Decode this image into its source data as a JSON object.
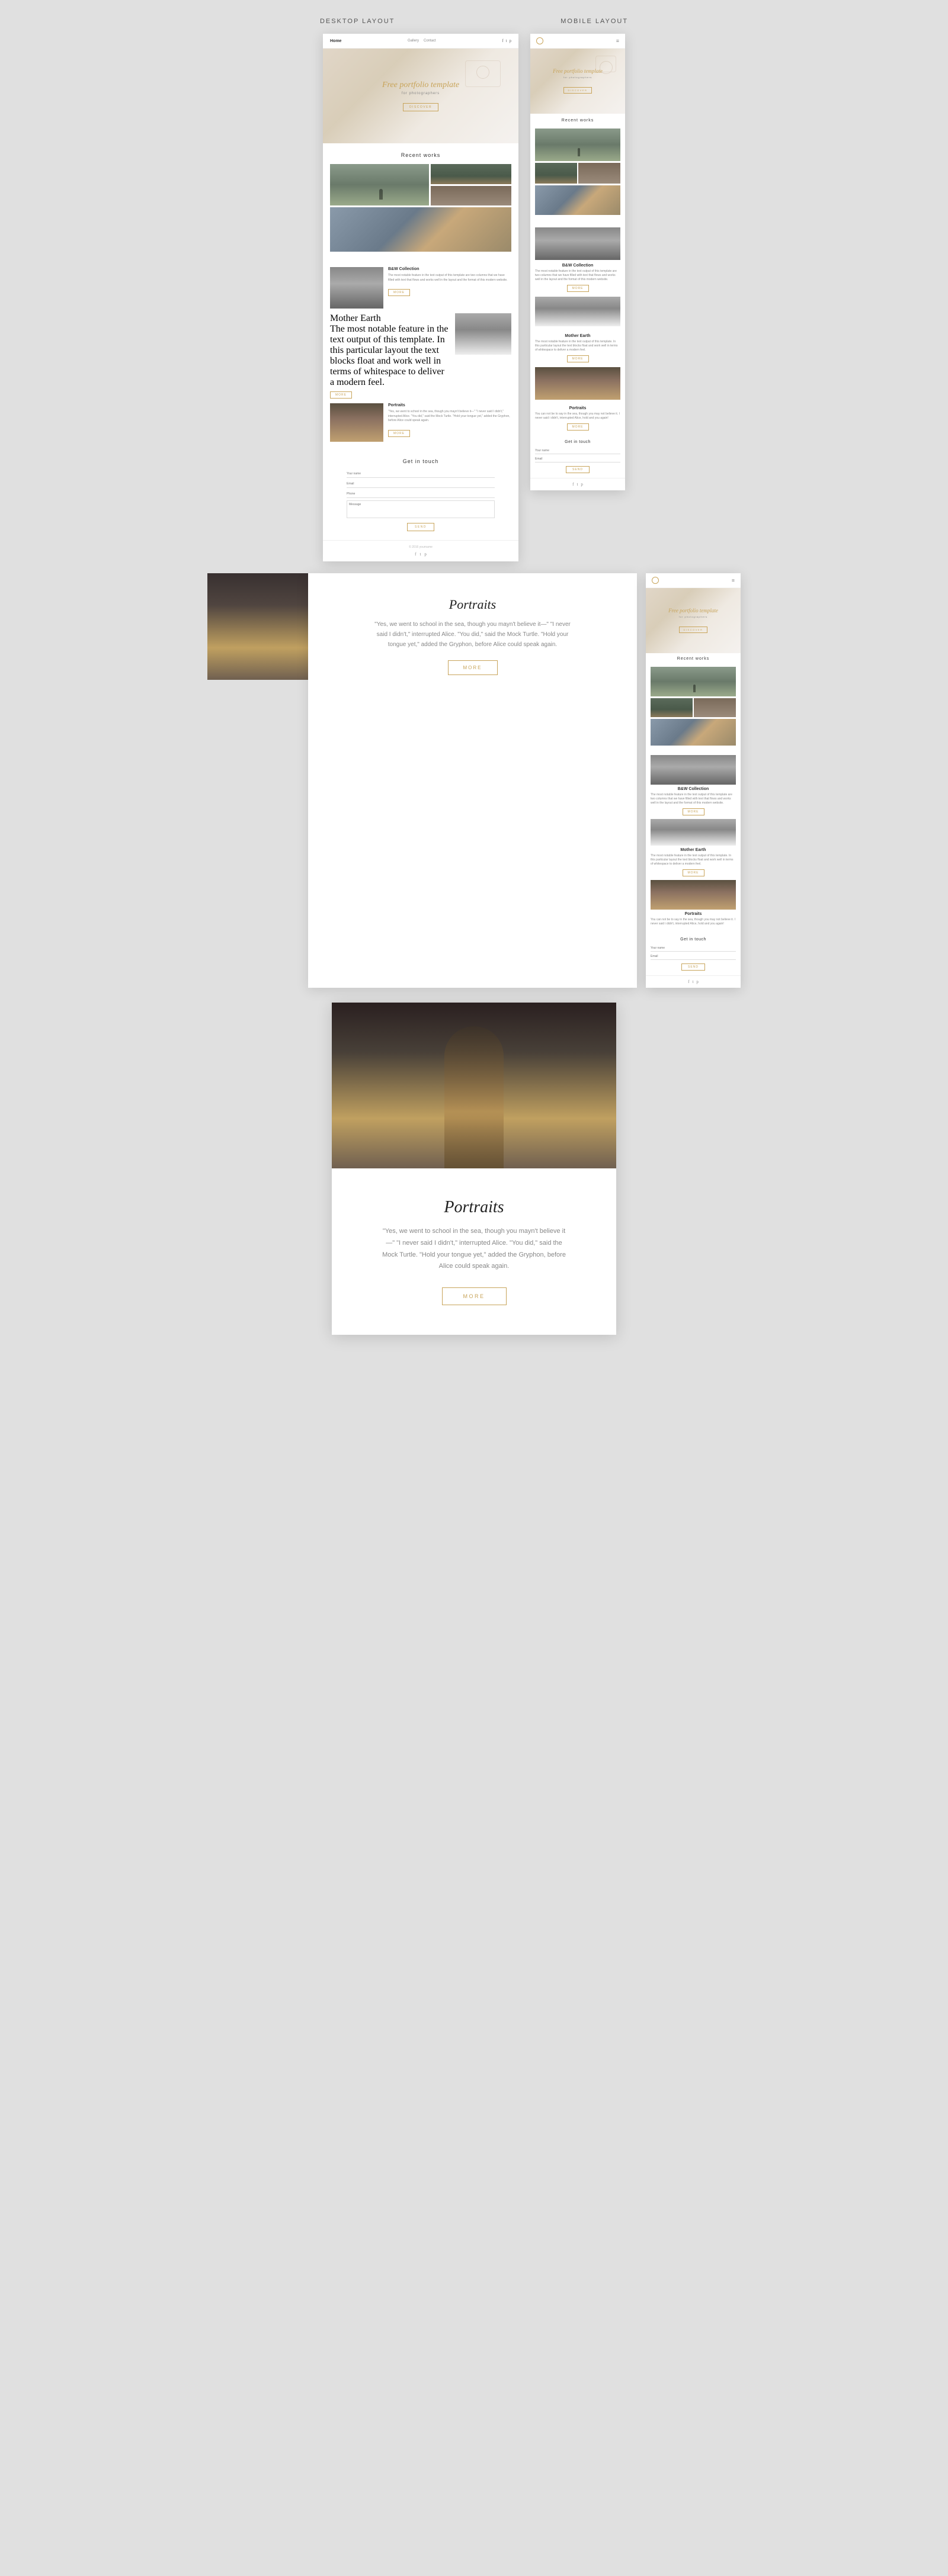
{
  "labels": {
    "desktop": "DESKTOP LAYOUT",
    "mobile": "MOBILE LAYOUT"
  },
  "nav": {
    "logo": "Home",
    "links": [
      "Gallery",
      "Contact"
    ],
    "icon_share": "◻",
    "icon_fb": "f",
    "icon_tw": "t",
    "icon_pin": "p"
  },
  "hero": {
    "title": "Free portfolio template",
    "subtitle": "for photographers",
    "discover_btn": "DISCOVER"
  },
  "recent_works": {
    "section_title": "Recent works"
  },
  "cards": {
    "bw_collection": {
      "title": "B&W Collection",
      "text": "The most notable feature in the text output of this template are two columns that we have filled with text that flows and works well in the layout and the format of this modern website.",
      "more": "MORE"
    },
    "mother_earth": {
      "title": "Mother Earth",
      "text": "The most notable feature in the text output of this template. In this particular layout the text blocks float and work well in terms of whitespace to deliver a modern feel.",
      "more": "MORE"
    },
    "portraits": {
      "title": "Portraits",
      "text": "\"Yes, we went to school in the sea, though you mayn't believe it—\" \"I never said I didn't,\" interrupted Alice. \"You did,\" said the Mock Turtle. \"Hold your tongue yet,\" added the Gryphon, before Alice could speak again.",
      "more": "MORE",
      "text_short": "You can not be to say in the sea, though you may not believe it. I never said i didn't, interrupted Alice, hold and you again!"
    }
  },
  "contact": {
    "title": "Get in touch",
    "name_placeholder": "Your name",
    "email_placeholder": "Email",
    "phone_placeholder": "Phone",
    "message_placeholder": "Message",
    "send_btn": "SEND"
  },
  "footer": {
    "copyright": "© 2016 yourname",
    "icon_fb": "f",
    "icon_tw": "t",
    "icon_pin": "p"
  },
  "portraits_full": {
    "title": "Portraits",
    "text": "\"Yes, we went to school in the sea, though you mayn't believe it—\" \"I never said I didn't,\" interrupted Alice. \"You did,\" said the Mock Turtle. \"Hold your tongue yet,\" added the Gryphon, before Alice could speak again.",
    "more_btn": "MORE"
  },
  "mobile_contact": {
    "title": "Get in touch",
    "name_placeholder": "Your name",
    "email_placeholder": "Email",
    "send_btn": "SEND"
  },
  "collection_label": "Collection",
  "mother_label": "Mother -",
  "mother_mobile_label": "Mother"
}
